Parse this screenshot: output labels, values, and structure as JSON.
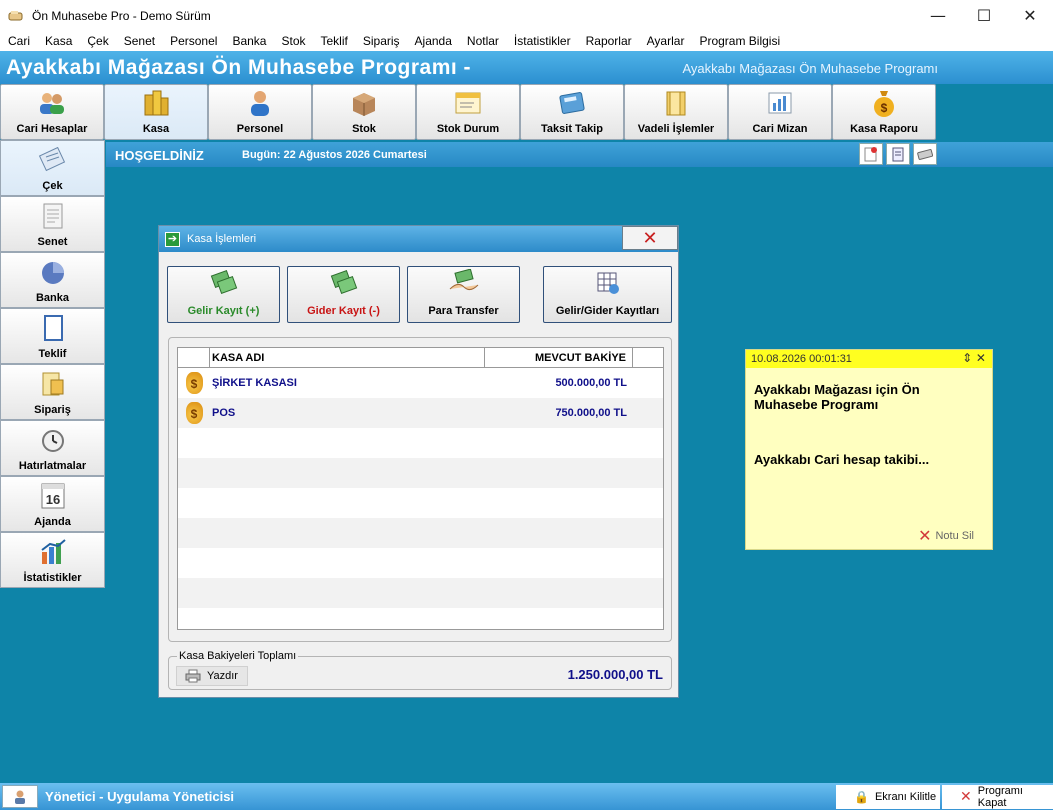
{
  "window": {
    "title": "Ön Muhasebe Pro - Demo Sürüm",
    "minimize": "—",
    "maximize": "☐",
    "close": "✕"
  },
  "menu": [
    "Cari",
    "Kasa",
    "Çek",
    "Senet",
    "Personel",
    "Banka",
    "Stok",
    "Teklif",
    "Sipariş",
    "Ajanda",
    "Notlar",
    "İstatistikler",
    "Raporlar",
    "Ayarlar",
    "Program Bilgisi"
  ],
  "banner": {
    "title": "Ayakkabı Mağazası Ön Muhasebe Programı -",
    "subtitle": "Ayakkabı Mağazası Ön Muhasebe Programı"
  },
  "toolbar": [
    {
      "label": "Cari Hesaplar",
      "icon": "people-icon"
    },
    {
      "label": "Kasa",
      "icon": "coins-icon"
    },
    {
      "label": "Personel",
      "icon": "person-icon"
    },
    {
      "label": "Stok",
      "icon": "box-icon"
    },
    {
      "label": "Stok Durum",
      "icon": "window-icon"
    },
    {
      "label": "Taksit Takip",
      "icon": "calculator-icon"
    },
    {
      "label": "Vadeli İşlemler",
      "icon": "folder-icon"
    },
    {
      "label": "Cari Mizan",
      "icon": "chart-icon"
    },
    {
      "label": "Kasa Raporu",
      "icon": "money-bag-icon"
    }
  ],
  "sidebar": [
    {
      "label": "Çek",
      "icon": "check-icon"
    },
    {
      "label": "Senet",
      "icon": "document-icon"
    },
    {
      "label": "Banka",
      "icon": "pie-icon"
    },
    {
      "label": "Teklif",
      "icon": "paper-icon"
    },
    {
      "label": "Sipariş",
      "icon": "order-icon"
    },
    {
      "label": "Hatırlatmalar",
      "icon": "clock-icon"
    },
    {
      "label": "Ajanda",
      "icon": "calendar-icon"
    },
    {
      "label": "İstatistikler",
      "icon": "stats-icon"
    }
  ],
  "sidebar_calendar_day": "16",
  "welcome": {
    "greeting": "HOŞGELDİNİZ",
    "today": "Bugün: 22 Ağustos 2026 Cumartesi"
  },
  "dialog": {
    "title": "Kasa İşlemleri",
    "close": "✕",
    "buttons": {
      "income": "Gelir Kayıt (+)",
      "expense": "Gider Kayıt (-)",
      "transfer": "Para Transfer",
      "records": "Gelir/Gider Kayıtları"
    },
    "columns": {
      "name": "KASA ADI",
      "balance": "MEVCUT BAKİYE"
    },
    "rows": [
      {
        "name": "ŞİRKET KASASI",
        "balance": "500.000,00 TL"
      },
      {
        "name": "POS",
        "balance": "750.000,00 TL"
      }
    ],
    "total_legend": "Kasa Bakiyeleri Toplamı",
    "print": "Yazdır",
    "total": "1.250.000,00 TL"
  },
  "note": {
    "date": "10.08.2026 00:01:31",
    "controls": "⇕ ✕",
    "line1": "Ayakkabı Mağazası için Ön Muhasebe Programı",
    "line2": "Ayakkabı Cari hesap takibi...",
    "delete": "Notu Sil"
  },
  "status": {
    "user": "Yönetici - Uygulama Yöneticisi",
    "lock": "Ekranı Kilitle",
    "quit": "Programı Kapat"
  },
  "colors": {
    "desktop": "#0e84a8",
    "banner": "#2b8fd0",
    "note_bg": "#ffffc0",
    "note_header": "#ffff20",
    "income": "#2a8a2a",
    "expense": "#c81414",
    "value_text": "#10108a"
  }
}
